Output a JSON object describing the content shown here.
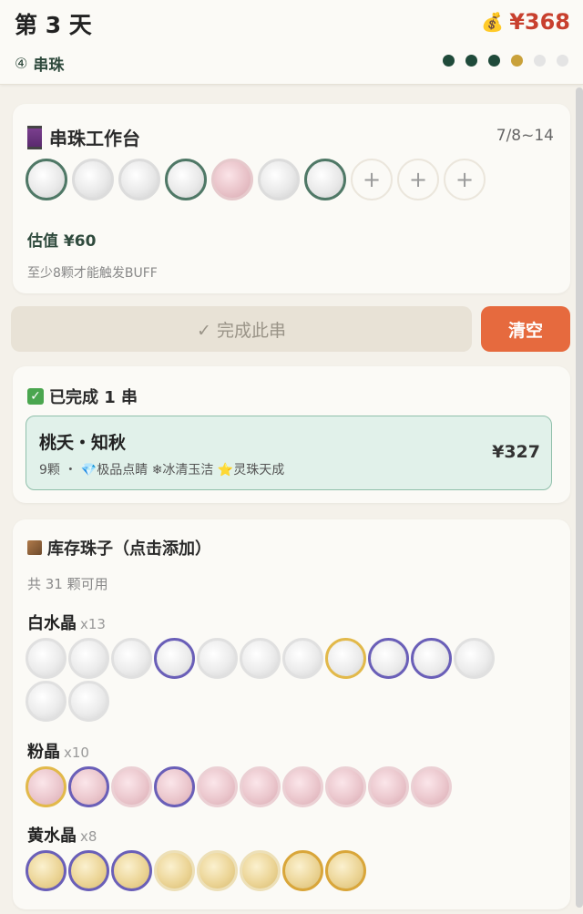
{
  "header": {
    "day_title": "第 3 天",
    "money_icon": "money-bag-icon",
    "money": "¥368",
    "step_number": "④",
    "step_label": "串珠",
    "progress": [
      {
        "state": "done",
        "color": "#1f4a3a"
      },
      {
        "state": "done",
        "color": "#1f4a3a"
      },
      {
        "state": "done",
        "color": "#1f4a3a"
      },
      {
        "state": "current",
        "color": "#c9a13a"
      },
      {
        "state": "todo",
        "color": "#e4e4e4"
      },
      {
        "state": "todo",
        "color": "#e4e4e4"
      }
    ]
  },
  "workbench": {
    "icon": "thread-spool-icon",
    "title": "串珠工作台",
    "count": "7/8~14",
    "beads": [
      "white-green",
      "white",
      "white",
      "white-green",
      "pink",
      "white",
      "white-green"
    ],
    "empty_slots": 3,
    "plus_label": "+",
    "valuation": "估值 ¥60",
    "hint": "至少8颗才能触发BUFF"
  },
  "actions": {
    "finish_label": "✓ 完成此串",
    "clear_label": "清空"
  },
  "completed": {
    "icon": "checkbox-icon",
    "title": "已完成 1 串",
    "strands": [
      {
        "name": "桃夭・知秋",
        "meta": "9颗 ・ 💎极品点睛 ❄冰清玉洁 ⭐灵珠天成",
        "price": "¥327"
      }
    ]
  },
  "inventory": {
    "icon": "box-icon",
    "title": "库存珠子（点击添加）",
    "subtitle": "共 31 颗可用",
    "groups": [
      {
        "name": "白水晶",
        "count": "x13",
        "beads": [
          "w",
          "w",
          "w",
          "w-blue",
          "w",
          "w",
          "w",
          "w-gold",
          "w-blue",
          "w-blue",
          "w",
          "w",
          "w"
        ]
      },
      {
        "name": "粉晶",
        "count": "x10",
        "beads": [
          "p-gold",
          "p-blue",
          "p",
          "p-blue",
          "p",
          "p",
          "p",
          "p",
          "p",
          "p"
        ]
      },
      {
        "name": "黄水晶",
        "count": "x8",
        "beads": [
          "y-blue",
          "y-blue",
          "y-blue",
          "y",
          "y",
          "y",
          "y-gold",
          "y-gold"
        ]
      }
    ]
  },
  "colors": {
    "accent_red": "#c8402e",
    "clear_button": "#e66a3e",
    "dark_green": "#2f4a3d"
  }
}
